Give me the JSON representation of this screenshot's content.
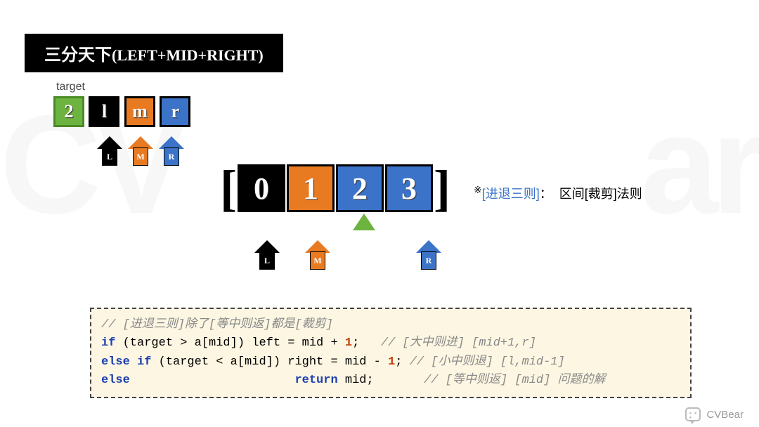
{
  "title_main": "三分天下",
  "title_sub": "(LEFT+MID+RIGHT)",
  "target_label": "target",
  "row1": {
    "target": "2",
    "cells": [
      "l",
      "m",
      "r"
    ]
  },
  "ptr": {
    "L": "L",
    "M": "M",
    "R": "R"
  },
  "row2": {
    "lb": "[",
    "rb": "]",
    "cells": [
      "0",
      "1",
      "2",
      "3"
    ]
  },
  "caption": {
    "star": "※",
    "rule": "[进退三则]",
    "sep": "：",
    "t1": "区间",
    "crop": "[裁剪]",
    "t2": "法则"
  },
  "code": {
    "c1": "// [进退三则]除了[等中则返]都是[裁剪]",
    "k_if": "if",
    "cond1": " (target > a[mid])      left = mid + ",
    "one": "1",
    "sc": ";",
    "cm1": "// [大中则进] [mid+1,r]",
    "k_elseif": "else if",
    "cond2": " (target < a[mid]) right = mid - ",
    "cm2": "// [小中则退] [l,mid-1]",
    "k_else": "else",
    "pad": "                       ",
    "k_return": "return",
    "ret": " mid;       ",
    "cm3": "// [等中则返] [mid] 问题的解"
  },
  "footer": "CVBear"
}
